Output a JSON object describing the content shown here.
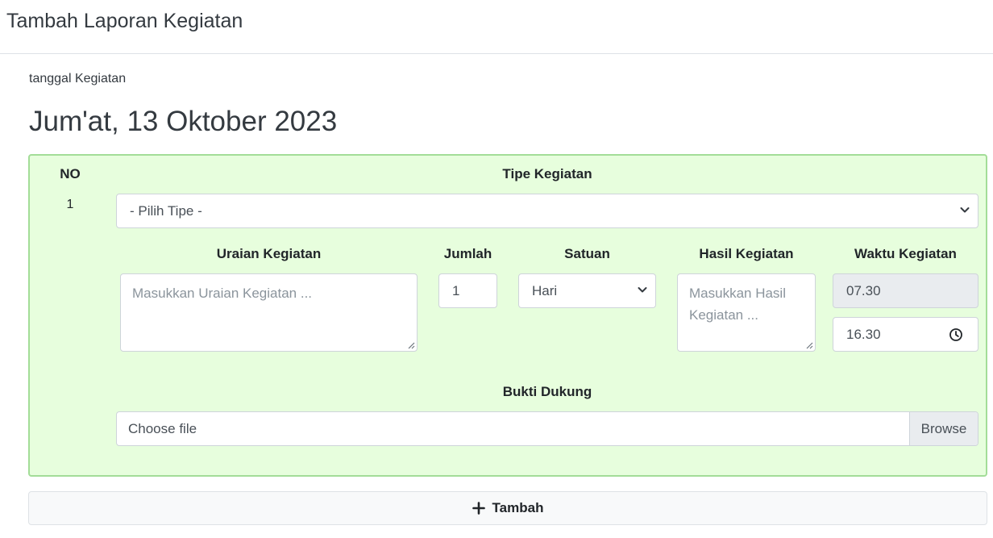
{
  "page": {
    "title": "Tambah Laporan Kegiatan"
  },
  "date": {
    "label": "tanggal Kegiatan",
    "value": "Jum'at, 13 Oktober 2023"
  },
  "table": {
    "headers": {
      "no": "NO",
      "tipe": "Tipe Kegiatan",
      "uraian": "Uraian Kegiatan",
      "jumlah": "Jumlah",
      "satuan": "Satuan",
      "hasil": "Hasil Kegiatan",
      "waktu": "Waktu Kegiatan",
      "bukti": "Bukti Dukung"
    },
    "row": {
      "no": "1",
      "tipe_selected": "- Pilih Tipe -",
      "uraian_placeholder": "Masukkan Uraian Kegiatan ...",
      "jumlah_value": "1",
      "satuan_selected": "Hari",
      "hasil_placeholder": "Masukkan Hasil Kegiatan ...",
      "waktu_start": "07.30",
      "waktu_end": "16.30",
      "file_label": "Choose file",
      "browse_label": "Browse"
    }
  },
  "actions": {
    "add_label": "Tambah"
  },
  "colors": {
    "card_bg": "#e7fedd",
    "card_border": "#a3dd98"
  },
  "icons": {
    "select_chevron": "chevron-down-icon",
    "time": "clock-icon",
    "add": "plus-icon"
  }
}
